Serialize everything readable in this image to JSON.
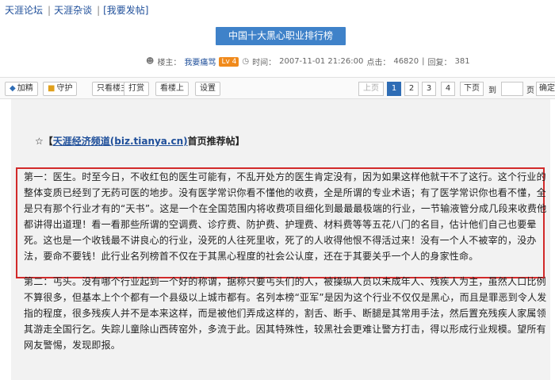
{
  "breadcrumb": {
    "items": [
      "天涯论坛",
      "天涯杂谈",
      "[我要发帖]"
    ],
    "separator": "|"
  },
  "post": {
    "title": "中国十大黑心职业排行榜",
    "author_label": "楼主：",
    "author": "我要痛骂",
    "level": "Lv 4",
    "time_label": "时间：",
    "time": "2007-11-01 21:26:00",
    "clicks_label": "点击：",
    "clicks": "46820",
    "replies_label": "回复：",
    "replies": "381"
  },
  "toolbar": {
    "buttons": [
      "只看楼主",
      "打赏",
      "看楼上",
      "设置"
    ],
    "left_buttons": [
      "加精",
      "守护"
    ],
    "pagination": {
      "prev": "上页",
      "pages": [
        "1",
        "2",
        "3",
        "4"
      ],
      "current": "1",
      "next": "下页",
      "jump_label": "到",
      "page_label": "页",
      "go": "确定"
    }
  },
  "recommendation": {
    "prefix": "☆【",
    "link": "天涯经济频道(biz.tianya.cn)",
    "suffix": "首页推荐帖】"
  },
  "paragraphs": [
    "第一：医生。时至今日，不收红包的医生可能有，不乱开处方的医生肯定没有，因为如果这样他就干不了这行。这个行业的整体变质已经到了无药可医的地步。没有医学常识你看不懂他的收费，全是所谓的专业术语；有了医学常识你也看不懂，全是只有那个行业才有的“天书”。这是一个在全国范围内将收费项目细化到最最最极端的行业，一节输液管分成几段来收费他都讲得出道理！看一看那些所谓的空调费、诊疗费、防护费、护理费、材料费等等五花八门的名目，估计他们自己也要晕死。这也是一个收钱最不讲良心的行业，没死的人往死里收，死了的人收得他恨不得活过来！没有一个人不被宰的，没办法，要命不要钱！此行业名列榜首不仅在于其黑心程度的社会公认度，还在于其要关乎一个人的身家性命。",
    "第二：丐头。没有哪个行业起到一个好的称谓，据称只要丐头们的人，被操纵人员以未成年人、残疾人为主，虽然人口比例不算很多，但基本上个个都有一个县级以上城市都有。名列本榜“亚军”是因为这个行业不仅仅是黑心，而且是罪恶到令人发指的程度，很多残疾人并不是本来这样，而是被他们弄成这样的，割舌、断手、断腿是其常用手法，然后置充残疾人家属领其游走全国行乞。失踪儿童除山西砖窑外，多流于此。因其特殊性，较黑社会更难让警方打击，得以形成行业规模。望所有网友警惕，发现即报。"
  ],
  "icons": {
    "user": "user-icon",
    "clock": "clock-icon",
    "star": "star-icon",
    "highlight": "#d22a2a",
    "title_bg": "#3f82c9",
    "active_page": "#2f6db5",
    "level_badge": "#f08a1c"
  }
}
